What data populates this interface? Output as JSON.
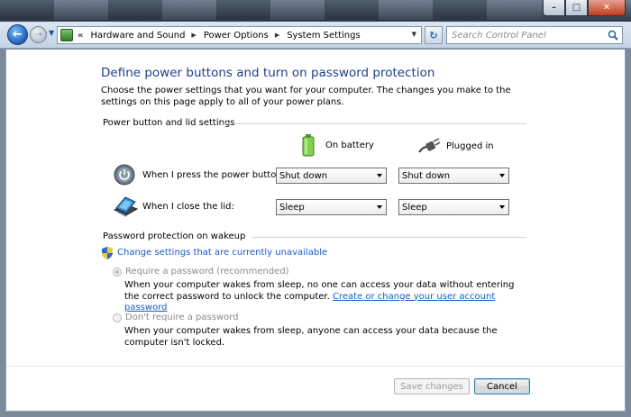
{
  "window": {
    "minimize_label": "–",
    "maximize_label": "□",
    "close_label": "✕"
  },
  "address": {
    "crumbs": [
      "Hardware and Sound",
      "Power Options",
      "System Settings"
    ],
    "raquo": "«"
  },
  "search": {
    "placeholder": "Search Control Panel"
  },
  "page": {
    "title": "Define power buttons and turn on password protection",
    "description": "Choose the power settings that you want for your computer. The changes you make to the settings on this page apply to all of your power plans."
  },
  "power_section": {
    "heading": "Power button and lid settings",
    "col_battery": "On battery",
    "col_plugged": "Plugged in",
    "rows": [
      {
        "label": "When I press the power button:",
        "battery": "Shut down",
        "plugged": "Shut down"
      },
      {
        "label": "When I close the lid:",
        "battery": "Sleep",
        "plugged": "Sleep"
      }
    ]
  },
  "password_section": {
    "heading": "Password protection on wakeup",
    "change_link": "Change settings that are currently unavailable",
    "require_label": "Require a password (recommended)",
    "require_desc": "When your computer wakes from sleep, no one can access your data without entering the correct password to unlock the computer.",
    "require_link": "Create or change your user account password",
    "norequire_label": "Don't require a password",
    "norequire_desc": "When your computer wakes from sleep, anyone can access your data because the computer isn't locked.",
    "selected": "require"
  },
  "footer": {
    "save_label": "Save changes",
    "cancel_label": "Cancel"
  },
  "colors": {
    "title_blue": "#1e3f8f",
    "link_blue": "#1a5ac8"
  }
}
